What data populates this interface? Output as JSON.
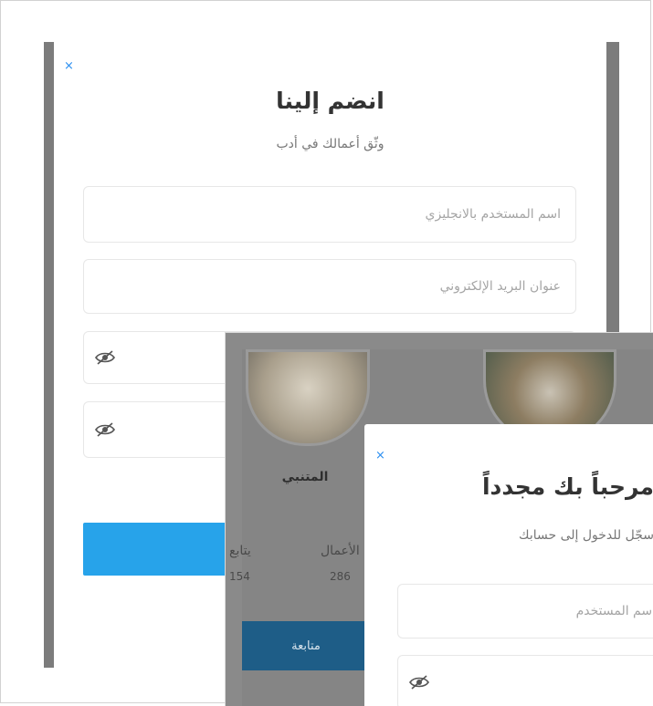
{
  "signup": {
    "close_label": "×",
    "title": "انضم إلينا",
    "subtitle": "وثّق أعمالك في أدب",
    "username_placeholder": "اسم المستخدم بالانجليزي",
    "email_placeholder": "عنوان البريد الإلكتروني"
  },
  "poets_page": {
    "poet_name": "المتنبي",
    "stats": [
      {
        "label": "الأعمال",
        "value": "286"
      },
      {
        "label": "يتابع",
        "value": "154"
      }
    ],
    "follow_label": "متابعة"
  },
  "login": {
    "close_label": "×",
    "title": "مرحباً بك مجدداً",
    "subtitle": "سجّل للدخول إلى حسابك",
    "username_placeholder": "اسم المستخدم"
  },
  "colors": {
    "accent": "#27a3ea",
    "follow_button": "#1e5d87",
    "close_icon": "#2a8ef0"
  },
  "icons": [
    "close-icon",
    "eye-slash-icon"
  ]
}
